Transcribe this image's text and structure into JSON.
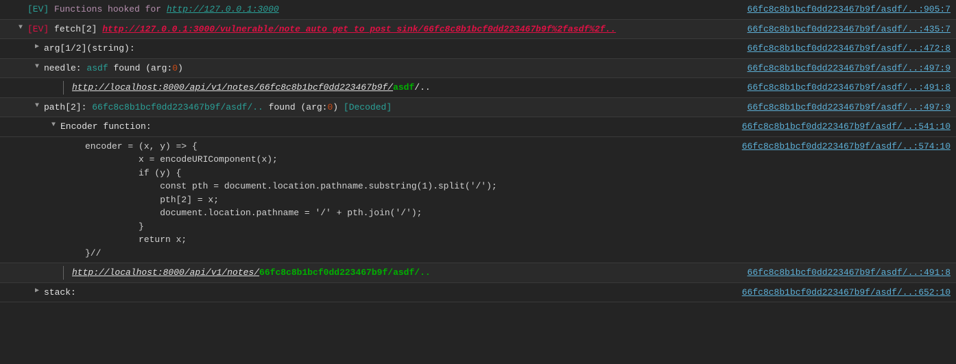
{
  "rows": [
    {
      "id": "r0",
      "indent": 0,
      "disclosure": null,
      "segments": [
        {
          "cls": "tag-ev",
          "text": "[EV]"
        },
        {
          "cls": "white",
          "text": "  "
        },
        {
          "cls": "purple",
          "text": "Functions hooked for"
        },
        {
          "cls": "white",
          "text": " "
        },
        {
          "cls": "teal-italic",
          "text": "http://127.0.0.1:3000"
        }
      ],
      "source": {
        "file": "66fc8c8b1bcf0dd223467b9f/asdf/..",
        "loc": ":905:7"
      }
    },
    {
      "id": "r1",
      "indent": 0,
      "disclosure": "down",
      "alt": true,
      "segments": [
        {
          "cls": "tag-ev-red",
          "text": "[EV]"
        },
        {
          "cls": "white",
          "text": "  "
        },
        {
          "cls": "white",
          "text": "fetch[2] "
        },
        {
          "cls": "red-underline",
          "text": "http://127.0.0.1:3000/vulnerable/note_auto_get_to_post_sink/66fc8c8b1bcf0dd223467b9f%2fasdf%2f.."
        }
      ],
      "source": {
        "file": "66fc8c8b1bcf0dd223467b9f/asdf/..",
        "loc": ":435:7"
      }
    },
    {
      "id": "r2",
      "indent": 1,
      "disclosure": "right",
      "segments": [
        {
          "cls": "white",
          "text": "arg[1/2](string):"
        }
      ],
      "source": {
        "file": "66fc8c8b1bcf0dd223467b9f/asdf/..",
        "loc": ":472:8"
      }
    },
    {
      "id": "r3",
      "indent": 1,
      "disclosure": "down",
      "alt": true,
      "segments": [
        {
          "cls": "white",
          "text": "needle: "
        },
        {
          "cls": "teal",
          "text": "asdf"
        },
        {
          "cls": "white",
          "text": " found (arg:"
        },
        {
          "cls": "orange",
          "text": "0"
        },
        {
          "cls": "white",
          "text": ")"
        }
      ],
      "source": {
        "file": "66fc8c8b1bcf0dd223467b9f/asdf/..",
        "loc": ":497:9"
      }
    },
    {
      "id": "r4",
      "indent": 2,
      "vbar": true,
      "segments": [
        {
          "cls": "url-italic",
          "text": "http://localhost:8000/api/v1/notes/66fc8c8b1bcf0dd223467b9f/"
        },
        {
          "cls": "green",
          "text": "asdf"
        },
        {
          "cls": "white",
          "text": "/.."
        }
      ],
      "source": {
        "file": "66fc8c8b1bcf0dd223467b9f/asdf/..",
        "loc": ":491:8"
      }
    },
    {
      "id": "r5",
      "indent": 1,
      "disclosure": "down",
      "alt": true,
      "segments": [
        {
          "cls": "white",
          "text": "path[2]: "
        },
        {
          "cls": "teal",
          "text": "66fc8c8b1bcf0dd223467b9f/asdf/.."
        },
        {
          "cls": "white",
          "text": " found (arg:"
        },
        {
          "cls": "orange",
          "text": "0"
        },
        {
          "cls": "white",
          "text": ") "
        },
        {
          "cls": "teal",
          "text": "[Decoded]"
        }
      ],
      "source": {
        "file": "66fc8c8b1bcf0dd223467b9f/asdf/..",
        "loc": ":497:9"
      }
    },
    {
      "id": "r6",
      "indent": 2,
      "disclosure": "down",
      "segments": [
        {
          "cls": "white",
          "text": "Encoder function:"
        }
      ],
      "source": {
        "file": "66fc8c8b1bcf0dd223467b9f/asdf/..",
        "loc": ":541:10"
      }
    },
    {
      "id": "r7",
      "indent": 3,
      "code": "encoder = (x, y) => {\n          x = encodeURIComponent(x);\n          if (y) {\n              const pth = document.location.pathname.substring(1).split('/');\n              pth[2] = x;\n              document.location.pathname = '/' + pth.join('/');\n          }\n          return x;\n}//",
      "source": {
        "file": "66fc8c8b1bcf0dd223467b9f/asdf/..",
        "loc": ":574:10"
      }
    },
    {
      "id": "r8",
      "indent": 2,
      "vbar": true,
      "alt": true,
      "segments": [
        {
          "cls": "url-italic",
          "text": "http://localhost:8000/api/v1/notes/"
        },
        {
          "cls": "green",
          "text": "66fc8c8b1bcf0dd223467b9f/asdf/.."
        }
      ],
      "source": {
        "file": "66fc8c8b1bcf0dd223467b9f/asdf/..",
        "loc": ":491:8"
      }
    },
    {
      "id": "r9",
      "indent": 1,
      "disclosure": "right",
      "segments": [
        {
          "cls": "white",
          "text": "stack:"
        }
      ],
      "source": {
        "file": "66fc8c8b1bcf0dd223467b9f/asdf/..",
        "loc": ":652:10"
      }
    }
  ]
}
